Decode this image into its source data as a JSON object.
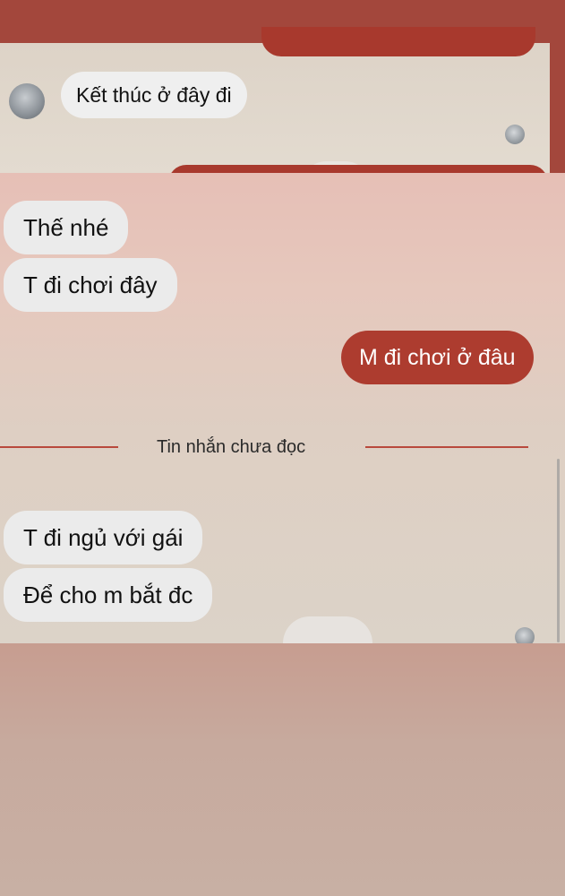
{
  "colors": {
    "accent_red": "#ad3c2f",
    "incoming_bubble": "#ebebeb",
    "divider": "#b9493c"
  },
  "screenshot_top": {
    "incoming_message": "Kết thúc ở đây đi",
    "avatar_icon": "user-avatar-icon"
  },
  "chat": {
    "messages": [
      {
        "side": "incoming",
        "text": "Thế nhé"
      },
      {
        "side": "incoming",
        "text": "T đi chơi đây"
      },
      {
        "side": "outgoing",
        "text": "M đi chơi ở đâu"
      }
    ],
    "unread_divider": "Tin nhắn chưa đọc",
    "unread_messages": [
      {
        "side": "incoming",
        "text": "T đi ngủ với gái"
      },
      {
        "side": "incoming",
        "text": "Để cho m bắt đc"
      }
    ]
  }
}
